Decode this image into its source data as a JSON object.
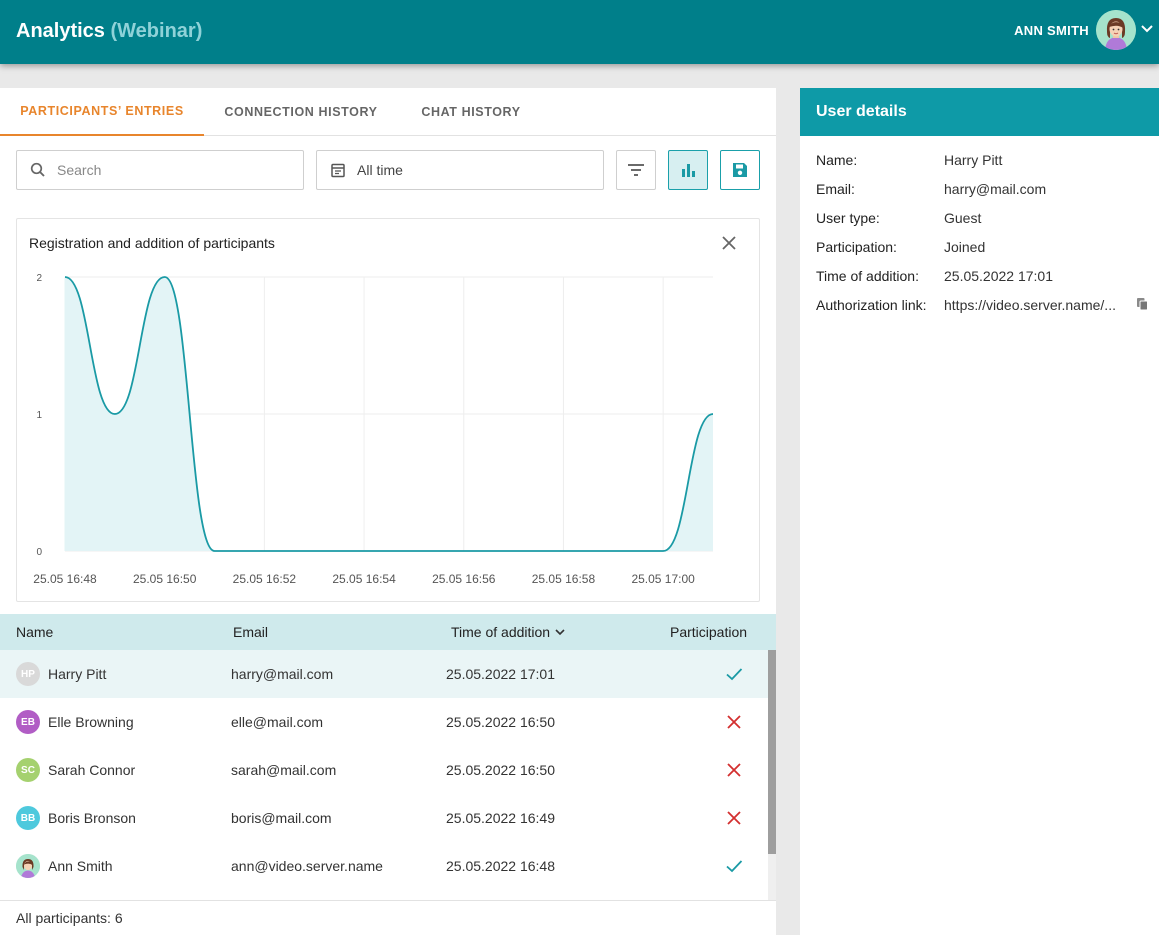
{
  "header": {
    "title": "Analytics",
    "subtitle": "(Webinar)",
    "user_name": "ANN SMITH"
  },
  "tabs": [
    {
      "label": "PARTICIPANTS’ ENTRIES",
      "active": true
    },
    {
      "label": "CONNECTION HISTORY",
      "active": false
    },
    {
      "label": "CHAT HISTORY",
      "active": false
    }
  ],
  "toolbar": {
    "search_placeholder": "Search",
    "search_value": "",
    "date_filter": "All time"
  },
  "chart_data": {
    "type": "area",
    "title": "Registration and addition of participants",
    "x": [
      "25.05 16:48",
      "25.05 16:49",
      "25.05 16:50",
      "25.05 16:51",
      "25.05 16:52",
      "25.05 16:53",
      "25.05 16:54",
      "25.05 16:55",
      "25.05 16:56",
      "25.05 16:57",
      "25.05 16:58",
      "25.05 16:59",
      "25.05 17:00",
      "25.05 17:01"
    ],
    "y": [
      2,
      1,
      2,
      0,
      0,
      0,
      0,
      0,
      0,
      0,
      0,
      0,
      0,
      1
    ],
    "x_tick_labels": [
      "25.05 16:48",
      "25.05 16:50",
      "25.05 16:52",
      "25.05 16:54",
      "25.05 16:56",
      "25.05 16:58",
      "25.05 17:00"
    ],
    "y_tick_labels": [
      "2",
      "1",
      "0"
    ],
    "ylim": [
      0,
      2
    ],
    "grid": true,
    "line_color": "#1a9aa5",
    "fill_color": "#e3f4f6"
  },
  "table": {
    "columns": [
      "Name",
      "Email",
      "Time of addition",
      "Participation"
    ],
    "sorted_column": "Time of addition",
    "rows": [
      {
        "initials": "HP",
        "avatar_color": "#d9d9d9",
        "name": "Harry Pitt",
        "email": "harry@mail.com",
        "time": "25.05.2022 17:01",
        "participation": "joined",
        "selected": true
      },
      {
        "initials": "EB",
        "avatar_color": "#b15dc5",
        "name": "Elle Browning",
        "email": "elle@mail.com",
        "time": "25.05.2022 16:50",
        "participation": "not-joined",
        "selected": false
      },
      {
        "initials": "SC",
        "avatar_color": "#a5d16f",
        "name": "Sarah Connor",
        "email": "sarah@mail.com",
        "time": "25.05.2022 16:50",
        "participation": "not-joined",
        "selected": false
      },
      {
        "initials": "BB",
        "avatar_color": "#4ec9dd",
        "name": "Boris Bronson",
        "email": "boris@mail.com",
        "time": "25.05.2022 16:49",
        "participation": "not-joined",
        "selected": false
      },
      {
        "initials": "",
        "avatar_color": "#9fe0c8",
        "name": "Ann Smith",
        "email": "ann@video.server.name",
        "time": "25.05.2022 16:48",
        "participation": "joined",
        "selected": false
      }
    ],
    "footer": "All participants: 6"
  },
  "user_details": {
    "title": "User details",
    "fields": [
      {
        "label": "Name:",
        "value": "Harry Pitt"
      },
      {
        "label": "Email:",
        "value": "harry@mail.com"
      },
      {
        "label": "User type:",
        "value": "Guest"
      },
      {
        "label": "Participation:",
        "value": "Joined"
      },
      {
        "label": "Time of addition:",
        "value": "25.05.2022 17:01"
      },
      {
        "label": "Authorization link:",
        "value": "https://video.server.name/..."
      }
    ]
  },
  "colors": {
    "header_bg": "#007f8a",
    "accent": "#e8852c",
    "teal": "#1a9aa5",
    "check": "#1a9aa5",
    "cross": "#d32f2f"
  }
}
